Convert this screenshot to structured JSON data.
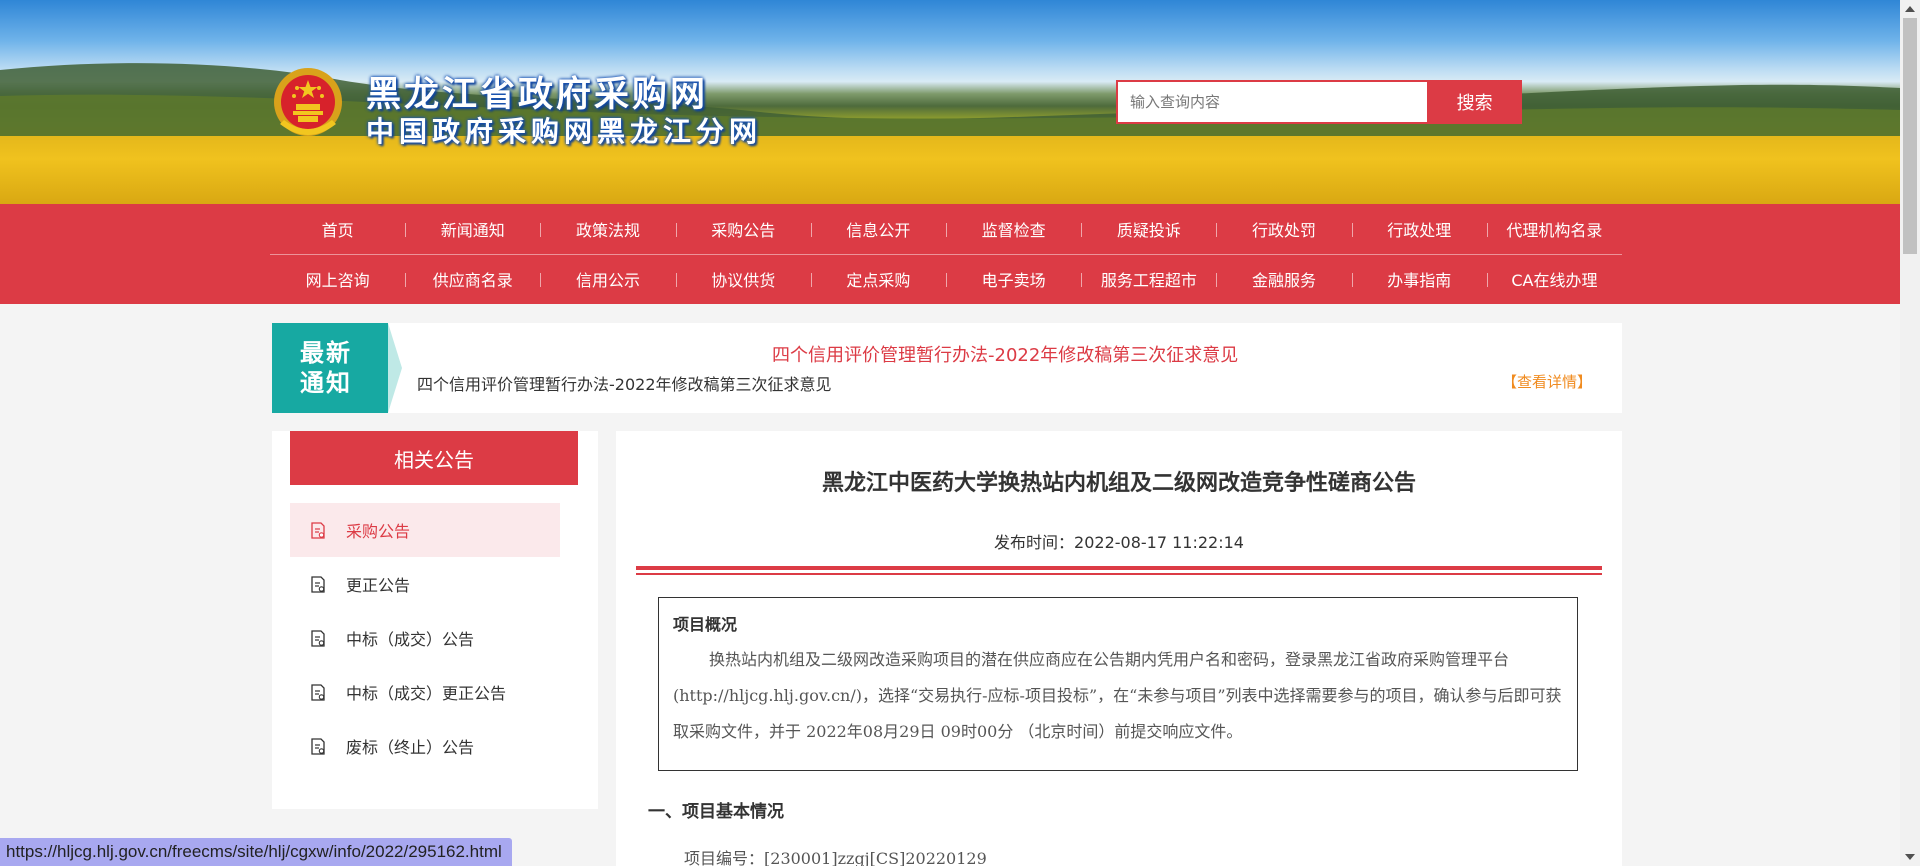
{
  "header": {
    "site_title": "黑龙江省政府采购网",
    "site_subtitle": "中国政府采购网黑龙江分网",
    "search": {
      "placeholder": "输入查询内容",
      "button_label": "搜索"
    }
  },
  "nav": {
    "row1": [
      "首页",
      "新闻通知",
      "政策法规",
      "采购公告",
      "信息公开",
      "监督检查",
      "质疑投诉",
      "行政处罚",
      "行政处理",
      "代理机构名录"
    ],
    "row2": [
      "网上咨询",
      "供应商名录",
      "信用公示",
      "协议供货",
      "定点采购",
      "电子卖场",
      "服务工程超市",
      "金融服务",
      "办事指南",
      "CA在线办理"
    ]
  },
  "notice": {
    "label_line1": "最新",
    "label_line2": "通知",
    "headline": "四个信用评价管理暂行办法-2022年修改稿第三次征求意见",
    "text": "四个信用评价管理暂行办法-2022年修改稿第三次征求意见",
    "more": "【查看详情】"
  },
  "sidebar": {
    "title": "相关公告",
    "items": [
      "采购公告",
      "更正公告",
      "中标（成交）公告",
      "中标（成交）更正公告",
      "废标（终止）公告"
    ]
  },
  "article": {
    "title": "黑龙江中医药大学换热站内机组及二级网改造竞争性磋商公告",
    "publish_label": "发布时间：",
    "publish_time": "2022-08-17 11:22:14",
    "overview_title": "项目概况",
    "overview_text": "换热站内机组及二级网改造采购项目的潜在供应商应在公告期内凭用户名和密码，登录黑龙江省政府采购管理平台(http://hljcg.hlj.gov.cn/)，选择“交易执行-应标-项目投标”，在“未参与项目”列表中选择需要参与的项目，确认参与后即可获取采购文件，并于 2022年08月29日 09时00分 （北京时间）前提交响应文件。",
    "section1_title": "一、项目基本情况",
    "project_no_label": "项目编号：",
    "project_no": "[230001]zzgj[CS]20220129"
  },
  "status_bar": {
    "url": "https://hljcg.hlj.gov.cn/freecms/site/hlj/cgxw/info/2022/295162.html"
  },
  "colors": {
    "accent": "#dc3b45",
    "notice_label": "#17a9a2",
    "notice_more": "#f08b1f"
  }
}
